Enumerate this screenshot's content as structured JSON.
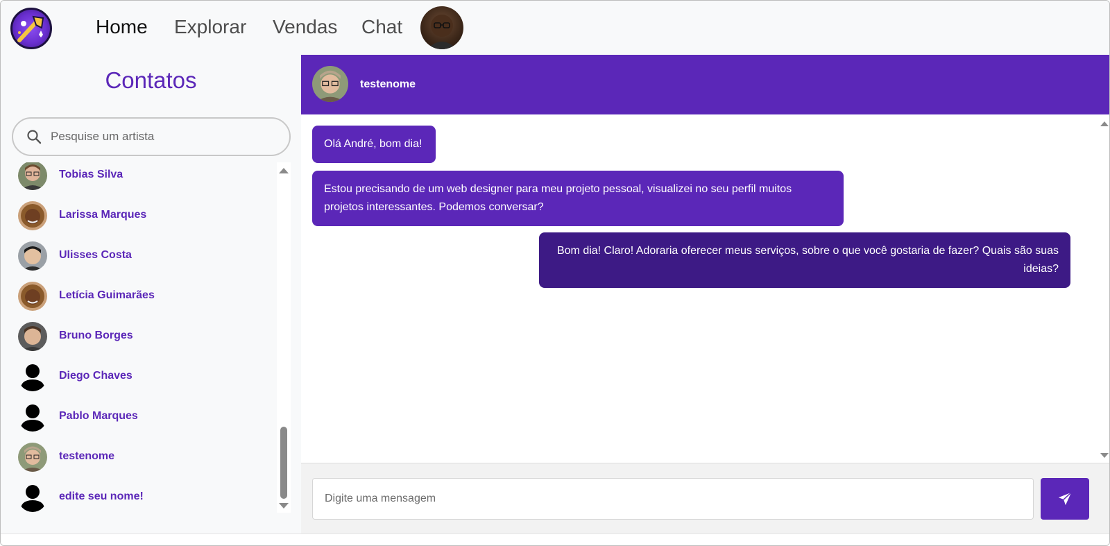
{
  "navbar": {
    "logo_icon": "logo-icon",
    "links": [
      {
        "label": "Home",
        "active": true
      },
      {
        "label": "Explorar",
        "active": false
      },
      {
        "label": "Vendas",
        "active": false
      },
      {
        "label": "Chat",
        "active": false
      }
    ],
    "avatar_icon": "user-avatar"
  },
  "sidebar": {
    "title": "Contatos",
    "search": {
      "placeholder": "Pesquise um artista",
      "value": "",
      "icon": "search-icon"
    },
    "contacts": [
      {
        "name": "Tobias Silva",
        "avatar": "photo"
      },
      {
        "name": "Larissa Marques",
        "avatar": "photo"
      },
      {
        "name": "Ulisses Costa",
        "avatar": "photo"
      },
      {
        "name": "Letícia Guimarães",
        "avatar": "photo"
      },
      {
        "name": "Bruno Borges",
        "avatar": "photo"
      },
      {
        "name": "Diego Chaves",
        "avatar": "default-user-icon"
      },
      {
        "name": "Pablo Marques",
        "avatar": "default-user-icon"
      },
      {
        "name": "testenome",
        "avatar": "photo"
      },
      {
        "name": "edite seu nome!",
        "avatar": "default-user-icon"
      }
    ]
  },
  "chat": {
    "header_name": "testenome",
    "messages": [
      {
        "direction": "in",
        "text": "Olá André, bom dia!"
      },
      {
        "direction": "in",
        "text": "Estou precisando de um web designer para meu projeto pessoal, visualizei no seu perfil muitos projetos interessantes. Podemos conversar?"
      },
      {
        "direction": "out",
        "text": "Bom dia! Claro! Adoraria oferecer meus serviços, sobre o que você gostaria de fazer? Quais são suas ideias?"
      }
    ],
    "input": {
      "placeholder": "Digite uma mensagem",
      "value": ""
    },
    "send_icon": "send-icon"
  },
  "colors": {
    "accent": "#5b27b8",
    "accent_dark": "#3d1a85",
    "nav_bg": "#f8f9fa"
  }
}
